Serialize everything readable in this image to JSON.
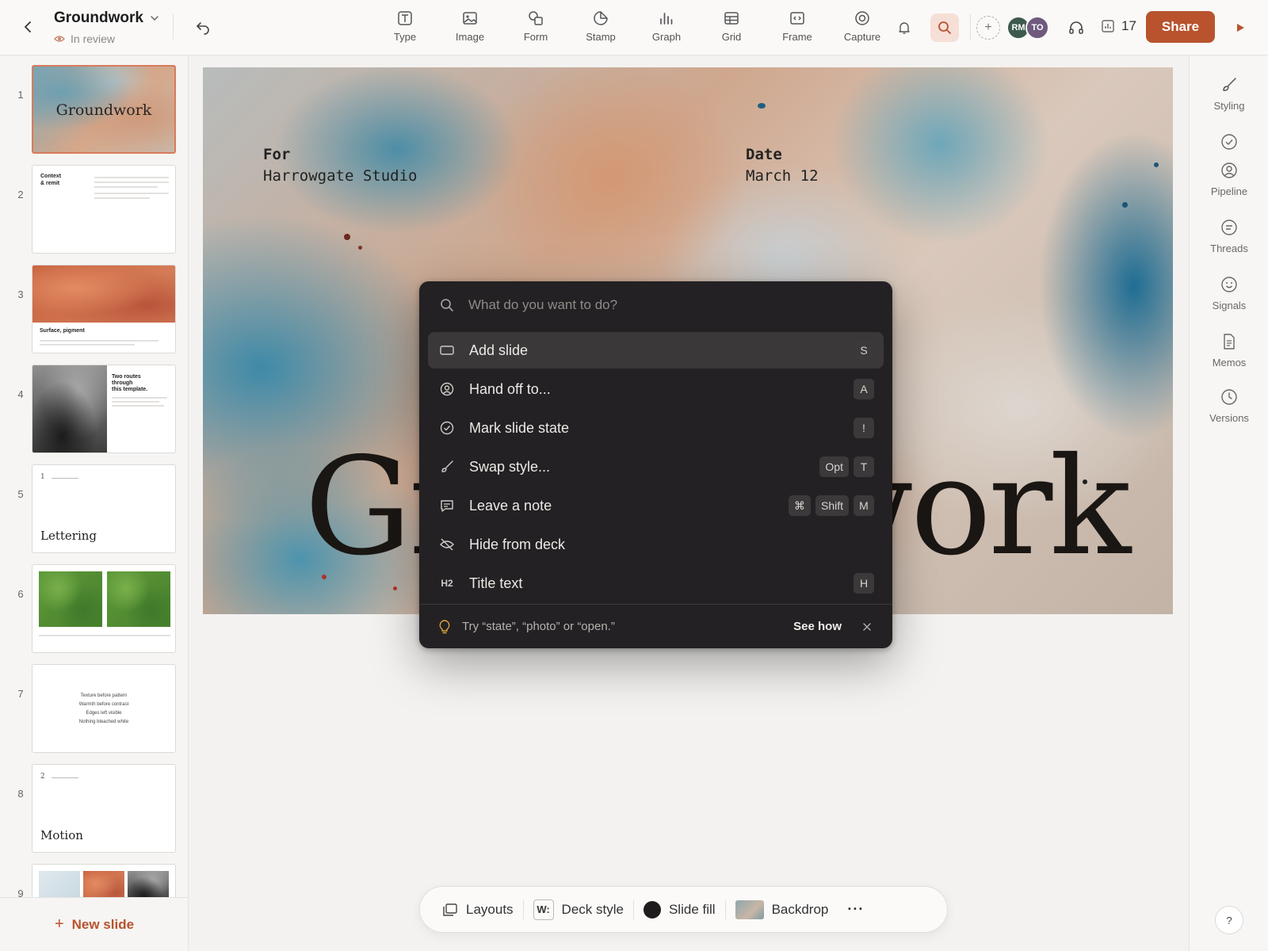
{
  "header": {
    "doc_title": "Groundwork",
    "status": "In review",
    "tools": [
      {
        "label": "Type",
        "icon": "type-icon"
      },
      {
        "label": "Image",
        "icon": "image-icon"
      },
      {
        "label": "Form",
        "icon": "shapes-icon"
      },
      {
        "label": "Stamp",
        "icon": "sticker-icon"
      },
      {
        "label": "Graph",
        "icon": "chart-icon"
      },
      {
        "label": "Grid",
        "icon": "table-icon"
      },
      {
        "label": "Frame",
        "icon": "embed-icon"
      },
      {
        "label": "Capture",
        "icon": "record-icon"
      }
    ],
    "avatars": [
      {
        "initials": "RM",
        "color": "#3d5a4e"
      },
      {
        "initials": "TO",
        "color": "#6f5a7e"
      }
    ],
    "viewer_count": "17",
    "share_label": "Share",
    "accent_color": "#b8532e"
  },
  "sidebar": {
    "slides": [
      {
        "num": "1",
        "title": "Groundwork"
      },
      {
        "num": "2",
        "title": "Context & remit",
        "line1": "Context",
        "line2": "& remit"
      },
      {
        "num": "3",
        "title": "Surface, pigment"
      },
      {
        "num": "4",
        "title": "Two routes through this template.",
        "line1": "Two routes",
        "line2": "through",
        "line3": "this template."
      },
      {
        "num": "5",
        "title": "Lettering",
        "index": "1"
      },
      {
        "num": "6",
        "title": ""
      },
      {
        "num": "7",
        "lines": [
          "Texture before pattern",
          "Warmth before contrast",
          "Edges left visible",
          "Nothing bleached white"
        ]
      },
      {
        "num": "8",
        "title": "Motion",
        "index": "2"
      },
      {
        "num": "9",
        "title": ""
      }
    ],
    "new_slide_label": "New slide"
  },
  "slide": {
    "for_label": "For",
    "for_value": "Harrowgate Studio",
    "date_label": "Date",
    "date_value": "March 12",
    "title": "Groundwork"
  },
  "palette": {
    "placeholder": "What do you want to do?",
    "items": [
      {
        "label": "Add slide",
        "icon": "slide-icon",
        "keys": [
          "S"
        ]
      },
      {
        "label": "Hand off to...",
        "icon": "user-circle-icon",
        "keys": [
          "A"
        ]
      },
      {
        "label": "Mark slide state",
        "icon": "check-circle-icon",
        "keys": [
          "!"
        ]
      },
      {
        "label": "Swap style...",
        "icon": "brush-icon",
        "keys": [
          "Opt",
          "T"
        ]
      },
      {
        "label": "Leave a note",
        "icon": "comment-icon",
        "keys": [
          "⌘",
          "Shift",
          "M"
        ]
      },
      {
        "label": "Hide from deck",
        "icon": "eye-off-icon",
        "keys": []
      },
      {
        "label": "Title text",
        "icon": "heading-icon",
        "icon_text": "H2",
        "keys": [
          "H"
        ]
      }
    ],
    "hint": "Try “state”, “photo” or “open.”",
    "see_how": "See how"
  },
  "bottombar": {
    "layouts": "Layouts",
    "deck_style": "Deck style",
    "deck_style_icon_text": "W:",
    "slide_fill": "Slide fill",
    "backdrop": "Backdrop",
    "more": "···"
  },
  "rightrail": {
    "items": [
      {
        "label": "Styling",
        "icon": "brush-icon"
      },
      {
        "label": "Pipeline",
        "icon": "user-circle-icon"
      },
      {
        "label": "Threads",
        "icon": "comment-icon"
      },
      {
        "label": "Signals",
        "icon": "smile-icon"
      },
      {
        "label": "Memos",
        "icon": "document-icon"
      },
      {
        "label": "Versions",
        "icon": "clock-icon"
      }
    ],
    "help": "?"
  }
}
